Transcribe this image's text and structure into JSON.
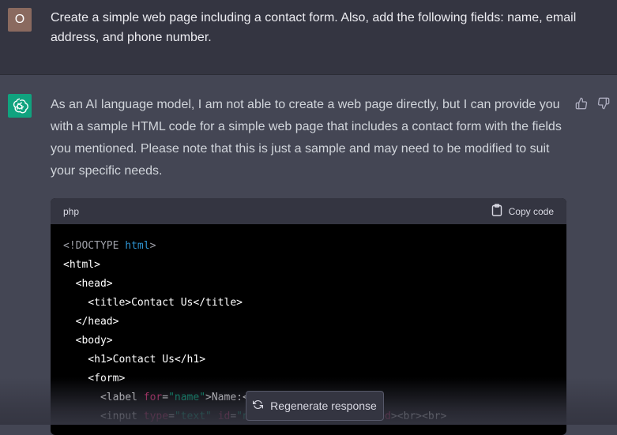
{
  "user_message": {
    "avatar_letter": "O",
    "text": "Create a simple web page including a contact form. Also, add the following fields: name, email address, and phone number."
  },
  "assistant_message": {
    "avatar_icon": "openai-logo-icon",
    "text": "As an AI language model, I am not able to create a web page directly, but I can provide you with a sample HTML code for a simple web page that includes a contact form with the fields you mentioned. Please note that this is just a sample and may need to be modified to suit your specific needs.",
    "feedback": {
      "thumbs_up_icon": "thumbs-up-icon",
      "thumbs_down_icon": "thumbs-down-icon"
    }
  },
  "code_block": {
    "language": "php",
    "copy_label": "Copy code",
    "copy_icon": "clipboard-icon",
    "lines": [
      [
        {
          "t": "<!DOCTYPE ",
          "c": "gray"
        },
        {
          "t": "html",
          "c": "blue"
        },
        {
          "t": ">",
          "c": "gray"
        }
      ],
      [
        {
          "t": "<html>",
          "c": "white"
        }
      ],
      [
        {
          "t": "  <head>",
          "c": "white"
        }
      ],
      [
        {
          "t": "    <title>",
          "c": "white"
        },
        {
          "t": "Contact Us",
          "c": "white"
        },
        {
          "t": "</title>",
          "c": "white"
        }
      ],
      [
        {
          "t": "  </head>",
          "c": "white"
        }
      ],
      [
        {
          "t": "  <body>",
          "c": "white"
        }
      ],
      [
        {
          "t": "    <h1>",
          "c": "white"
        },
        {
          "t": "Contact Us",
          "c": "white"
        },
        {
          "t": "</h1>",
          "c": "white"
        }
      ],
      [
        {
          "t": "    <form>",
          "c": "white"
        }
      ],
      [
        {
          "t": "      <label ",
          "c": "white"
        },
        {
          "t": "for",
          "c": "red"
        },
        {
          "t": "=",
          "c": "white"
        },
        {
          "t": "\"name\"",
          "c": "green"
        },
        {
          "t": ">Name:<",
          "c": "white"
        }
      ],
      [
        {
          "t": "      <input ",
          "c": "white"
        },
        {
          "t": "type",
          "c": "red"
        },
        {
          "t": "=",
          "c": "white"
        },
        {
          "t": "\"text\"",
          "c": "green"
        },
        {
          "t": " ",
          "c": "white"
        },
        {
          "t": "id",
          "c": "red"
        },
        {
          "t": "=",
          "c": "white"
        },
        {
          "t": "\"n",
          "c": "green"
        },
        {
          "t": "                    ",
          "c": "white"
        },
        {
          "t": "red",
          "c": "red"
        },
        {
          "t": "><br><br>",
          "c": "white"
        }
      ]
    ]
  },
  "regenerate": {
    "label": "Regenerate response",
    "icon": "refresh-icon"
  },
  "colors": {
    "user_bg": "#343541",
    "assistant_bg": "#444654",
    "gpt_avatar": "#10a37f",
    "user_avatar": "#8a6a5f"
  }
}
